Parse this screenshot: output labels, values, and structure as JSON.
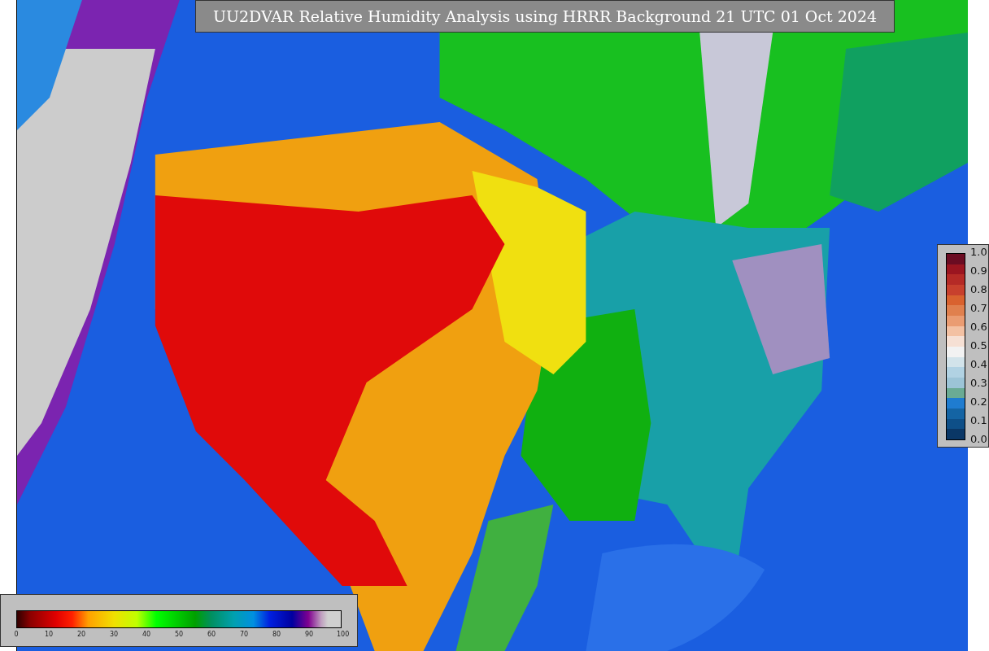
{
  "title": "UU2DVAR Relative Humidity Analysis using HRRR Background 21 UTC 01 Oct 2024",
  "colorbar": {
    "ticks": [
      "0",
      "10",
      "20",
      "30",
      "40",
      "50",
      "60",
      "70",
      "80",
      "90",
      "100"
    ]
  },
  "legend": {
    "ticks": [
      "1.0",
      "0.9",
      "0.8",
      "0.7",
      "0.6",
      "0.5",
      "0.4",
      "0.3",
      "0.2",
      "0.1",
      "0.0"
    ]
  }
}
